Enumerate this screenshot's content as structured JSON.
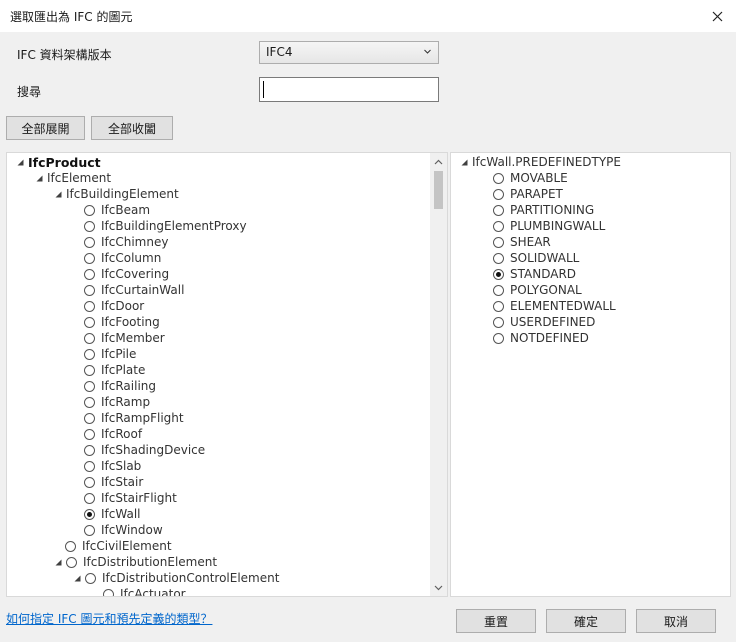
{
  "window": {
    "title": "選取匯出為 IFC 的圖元"
  },
  "form": {
    "schema_label": "IFC 資料架構版本",
    "schema_value": "IFC4",
    "search_label": "搜尋",
    "search_value": ""
  },
  "buttons": {
    "expand_all": "全部展開",
    "collapse_all": "全部收闔",
    "reset": "重置",
    "ok": "確定",
    "cancel": "取消"
  },
  "left_tree": [
    {
      "label": "IfcProduct",
      "level": 0,
      "node": "expanded",
      "bold": true
    },
    {
      "label": "IfcElement",
      "level": 1,
      "node": "expanded"
    },
    {
      "label": "IfcBuildingElement",
      "level": 2,
      "node": "expanded"
    },
    {
      "label": "IfcBeam",
      "level": 3,
      "node": "radio",
      "checked": false
    },
    {
      "label": "IfcBuildingElementProxy",
      "level": 3,
      "node": "radio",
      "checked": false
    },
    {
      "label": "IfcChimney",
      "level": 3,
      "node": "radio",
      "checked": false
    },
    {
      "label": "IfcColumn",
      "level": 3,
      "node": "radio",
      "checked": false
    },
    {
      "label": "IfcCovering",
      "level": 3,
      "node": "radio",
      "checked": false
    },
    {
      "label": "IfcCurtainWall",
      "level": 3,
      "node": "radio",
      "checked": false
    },
    {
      "label": "IfcDoor",
      "level": 3,
      "node": "radio",
      "checked": false
    },
    {
      "label": "IfcFooting",
      "level": 3,
      "node": "radio",
      "checked": false
    },
    {
      "label": "IfcMember",
      "level": 3,
      "node": "radio",
      "checked": false
    },
    {
      "label": "IfcPile",
      "level": 3,
      "node": "radio",
      "checked": false
    },
    {
      "label": "IfcPlate",
      "level": 3,
      "node": "radio",
      "checked": false
    },
    {
      "label": "IfcRailing",
      "level": 3,
      "node": "radio",
      "checked": false
    },
    {
      "label": "IfcRamp",
      "level": 3,
      "node": "radio",
      "checked": false
    },
    {
      "label": "IfcRampFlight",
      "level": 3,
      "node": "radio",
      "checked": false
    },
    {
      "label": "IfcRoof",
      "level": 3,
      "node": "radio",
      "checked": false
    },
    {
      "label": "IfcShadingDevice",
      "level": 3,
      "node": "radio",
      "checked": false
    },
    {
      "label": "IfcSlab",
      "level": 3,
      "node": "radio",
      "checked": false
    },
    {
      "label": "IfcStair",
      "level": 3,
      "node": "radio",
      "checked": false
    },
    {
      "label": "IfcStairFlight",
      "level": 3,
      "node": "radio",
      "checked": false
    },
    {
      "label": "IfcWall",
      "level": 3,
      "node": "radio",
      "checked": true
    },
    {
      "label": "IfcWindow",
      "level": 3,
      "node": "radio",
      "checked": false
    },
    {
      "label": "IfcCivilElement",
      "level": 2,
      "node": "radio",
      "checked": false
    },
    {
      "label": "IfcDistributionElement",
      "level": 2,
      "node": "expanded-radio",
      "checked": false
    },
    {
      "label": "IfcDistributionControlElement",
      "level": 3,
      "node": "expanded-radio",
      "checked": false
    },
    {
      "label": "IfcActuator",
      "level": 4,
      "node": "radio",
      "checked": false
    }
  ],
  "right_tree": {
    "root": "IfcWall.PREDEFINEDTYPE",
    "items": [
      {
        "label": "MOVABLE",
        "checked": false
      },
      {
        "label": "PARAPET",
        "checked": false
      },
      {
        "label": "PARTITIONING",
        "checked": false
      },
      {
        "label": "PLUMBINGWALL",
        "checked": false
      },
      {
        "label": "SHEAR",
        "checked": false
      },
      {
        "label": "SOLIDWALL",
        "checked": false
      },
      {
        "label": "STANDARD",
        "checked": true
      },
      {
        "label": "POLYGONAL",
        "checked": false
      },
      {
        "label": "ELEMENTEDWALL",
        "checked": false
      },
      {
        "label": "USERDEFINED",
        "checked": false
      },
      {
        "label": "NOTDEFINED",
        "checked": false
      }
    ]
  },
  "footer": {
    "help_link": "如何指定 IFC 圖元和預先定義的類型？"
  },
  "icons": {
    "close": "close-icon",
    "dropdown": "chevron-down-icon",
    "expanded": "expanded-triangle-icon",
    "scroll_up": "scroll-up-arrow-icon",
    "scroll_down": "scroll-down-arrow-icon"
  }
}
